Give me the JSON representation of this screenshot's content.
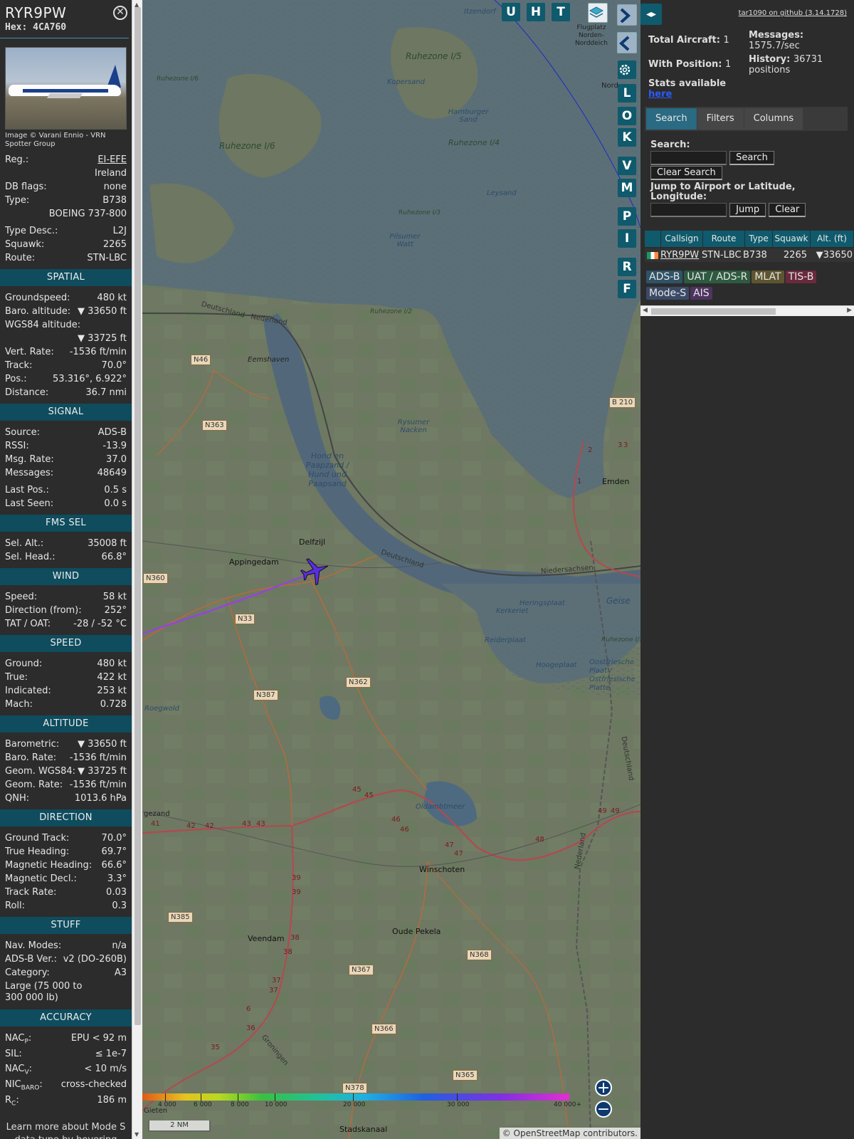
{
  "aircraft": {
    "callsign": "RYR9PW",
    "hex_label": "Hex:",
    "hex": "4CA760",
    "photo_credit": "Image © Varani Ennio - VRN Spotter Group",
    "reg_label": "Reg.:",
    "reg": "EI-EFE",
    "country": "Ireland",
    "dbflags_label": "DB flags:",
    "dbflags": "none",
    "type_label": "Type:",
    "type": "B738",
    "type_full": "BOEING 737-800",
    "typedesc_label": "Type Desc.:",
    "typedesc": "L2J",
    "squawk_label": "Squawk:",
    "squawk": "2265",
    "route_label": "Route:",
    "route": "STN-LBC"
  },
  "spatial": {
    "title": "SPATIAL",
    "groundspeed_label": "Groundspeed:",
    "groundspeed": "480 kt",
    "baro_label": "Baro. altitude:",
    "baro": "▼ 33650 ft",
    "wgs_label": "WGS84 altitude:",
    "wgs": "▼ 33725 ft",
    "vrate_label": "Vert. Rate:",
    "vrate": "-1536 ft/min",
    "track_label": "Track:",
    "track": "70.0°",
    "pos_label": "Pos.:",
    "pos": "53.316°, 6.922°",
    "dist_label": "Distance:",
    "dist": "36.7 nmi"
  },
  "signal": {
    "title": "SIGNAL",
    "source_label": "Source:",
    "source": "ADS-B",
    "rssi_label": "RSSI:",
    "rssi": "-13.9",
    "msgrate_label": "Msg. Rate:",
    "msgrate": "37.0",
    "messages_label": "Messages:",
    "messages": "48649",
    "lastpos_label": "Last Pos.:",
    "lastpos": "0.5 s",
    "lastseen_label": "Last Seen:",
    "lastseen": "0.0 s"
  },
  "fms": {
    "title": "FMS SEL",
    "selalt_label": "Sel. Alt.:",
    "selalt": "35008 ft",
    "selhead_label": "Sel. Head.:",
    "selhead": "66.8°"
  },
  "wind": {
    "title": "WIND",
    "speed_label": "Speed:",
    "speed": "58 kt",
    "dir_label": "Direction (from):",
    "dir": "252°",
    "tat_label": "TAT / OAT:",
    "tat": "-28 / -52 °C"
  },
  "speed": {
    "title": "SPEED",
    "ground_label": "Ground:",
    "ground": "480 kt",
    "true_label": "True:",
    "true": "422 kt",
    "ind_label": "Indicated:",
    "ind": "253 kt",
    "mach_label": "Mach:",
    "mach": "0.728"
  },
  "altitude": {
    "title": "ALTITUDE",
    "baro_label": "Barometric:",
    "baro": "▼ 33650 ft",
    "barorate_label": "Baro. Rate:",
    "barorate": "-1536 ft/min",
    "geom_label": "Geom. WGS84:",
    "geom": "▼ 33725 ft",
    "geomrate_label": "Geom. Rate:",
    "geomrate": "-1536 ft/min",
    "qnh_label": "QNH:",
    "qnh": "1013.6 hPa"
  },
  "direction": {
    "title": "DIRECTION",
    "gt_label": "Ground Track:",
    "gt": "70.0°",
    "th_label": "True Heading:",
    "th": "69.7°",
    "mh_label": "Magnetic Heading:",
    "mh": "66.6°",
    "md_label": "Magnetic Decl.:",
    "md": "3.3°",
    "tr_label": "Track Rate:",
    "tr": "0.03",
    "roll_label": "Roll:",
    "roll": "0.3"
  },
  "stuff": {
    "title": "STUFF",
    "nav_label": "Nav. Modes:",
    "nav": "n/a",
    "adsb_label": "ADS-B Ver.:",
    "adsb": "v2 (DO-260B)",
    "cat_label": "Category:",
    "cat": "A3",
    "cat_desc": "Large (75 000 to 300 000 lb)"
  },
  "accuracy": {
    "title": "ACCURACY",
    "nacp_label": "NAC",
    "nacp_sub": "P",
    "nacp": "EPU < 92 m",
    "sil_label": "SIL:",
    "sil": "≤ 1e-7",
    "nacv_label": "NAC",
    "nacv_sub": "V",
    "nacv": "< 10 m/s",
    "nic_label": "NIC",
    "nic_sub": "BARO",
    "nic": "cross-checked",
    "rc_label": "R",
    "rc_sub": "C",
    "rc": "186 m"
  },
  "footnote": "Learn more about Mode S data type by hovering over each data label",
  "map": {
    "buttons": [
      "U",
      "H",
      "T"
    ],
    "side_buttons": [
      "L",
      "O",
      "K",
      "V",
      "M",
      "P",
      "I",
      "R",
      "F"
    ],
    "towns": [
      "Delfzijl",
      "Appingedam",
      "Emden",
      "Winschoten",
      "Veendam",
      "Oude Pekela",
      "Stadskanaal",
      "Eemshaven",
      "gezand",
      "Gieten",
      "Nord"
    ],
    "waters": [
      "Hamburger Sand",
      "Kopersand",
      "Pilsumer Watt",
      "Leysand",
      "Rysumer Nacken",
      "Hond en Paapzand / Hund und Paapsand",
      "Heringsplaat",
      "Kerkeriet",
      "Reiderplaat",
      "Hoogeplaat",
      "Geise",
      "Oostfriesche Plaat / Ostfriesische Platte",
      "Oldambtmeer",
      "Roegwold",
      "Itzendorf",
      "Flugplatz Norden-Norddeich"
    ],
    "zones": [
      "Ruhezone I/5",
      "Ruhezone I/6",
      "Ruhezone I/4",
      "Ruhezone I/3",
      "Ruhezone I/2",
      "Ruhezone I/6",
      "Ruhezone I/1",
      "Ruhezone I/3"
    ],
    "borders": [
      "Deutschland",
      "Nederland",
      "Deutschland",
      "Niedersachsen",
      "Deutschland",
      "Nederland",
      "Groningen"
    ],
    "roads": [
      "N46",
      "N363",
      "N360",
      "N33",
      "N387",
      "N362",
      "N385",
      "N367",
      "N366",
      "N368",
      "N365",
      "N378",
      "B 210"
    ],
    "motorway_marks": [
      "41",
      "42",
      "42",
      "43",
      "43",
      "45",
      "45",
      "46",
      "46",
      "47",
      "47",
      "48",
      "49",
      "49",
      "39",
      "39",
      "38",
      "38",
      "37",
      "37",
      "36",
      "35",
      "6",
      "2",
      "3",
      "3",
      "1"
    ],
    "altitude_ticks": [
      "4 000",
      "6 000",
      "8 000",
      "10 000",
      "20 000",
      "30 000",
      "40 000+"
    ],
    "scale": "2 NM",
    "attribution_prefix": "© ",
    "attribution_link": "OpenStreetMap",
    "attribution_suffix": " contributors."
  },
  "panel": {
    "toggle_icon": "◂▸",
    "github": "tar1090 on github (3.14.1728)",
    "total_label": "Total Aircraft:",
    "total": "1",
    "withpos_label": "With Position:",
    "withpos": "1",
    "messages_label": "Messages:",
    "messages": "1575.7/sec",
    "history_label": "History:",
    "history": "36731 positions",
    "stats_label": "Stats available",
    "stats_link": "here",
    "tabs": [
      "Search",
      "Filters",
      "Columns"
    ],
    "search_label": "Search:",
    "search_button": "Search",
    "clear_search": "Clear Search",
    "jump_label": "Jump to Airport or Latitude, Longitude:",
    "jump_button": "Jump",
    "clear_button": "Clear",
    "columns": [
      "Callsign",
      "Route",
      "Type",
      "Squawk",
      "Alt. (ft)"
    ],
    "row": {
      "callsign": "RYR9PW",
      "route": "STN-LBC",
      "type": "B738",
      "squawk": "2265",
      "alt": "▼33650"
    },
    "sources": [
      "ADS-B",
      "UAT / ADS-R",
      "MLAT",
      "TIS-B",
      "Mode-S",
      "AIS"
    ]
  }
}
